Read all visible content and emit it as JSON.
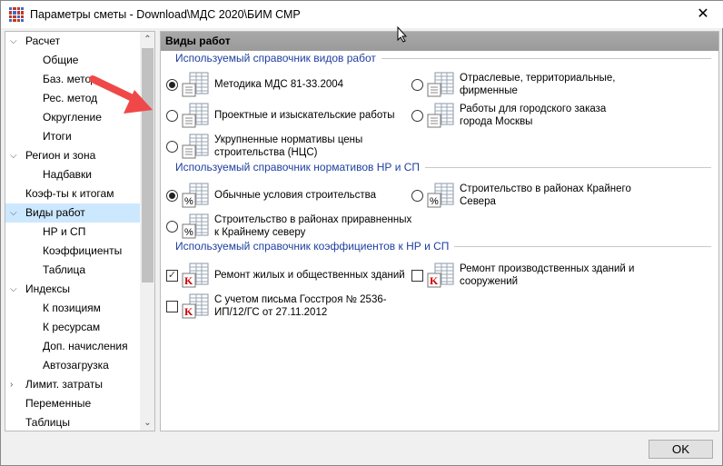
{
  "window": {
    "title": "Параметры сметы - Download\\МДС 2020\\БИМ СМР",
    "close": "✕"
  },
  "sidebar": {
    "items": [
      {
        "label": "Расчет",
        "level": 0,
        "chev": "⌵"
      },
      {
        "label": "Общие",
        "level": 1
      },
      {
        "label": "Баз. метод",
        "level": 1
      },
      {
        "label": "Рес. метод",
        "level": 1
      },
      {
        "label": "Округление",
        "level": 1
      },
      {
        "label": "Итоги",
        "level": 1
      },
      {
        "label": "Регион и зона",
        "level": 0,
        "chev": "⌵"
      },
      {
        "label": "Надбавки",
        "level": 1
      },
      {
        "label": "Коэф-ты к итогам",
        "level": 0
      },
      {
        "label": "Виды работ",
        "level": 0,
        "chev": "⌵",
        "selected": true
      },
      {
        "label": "НР и СП",
        "level": 1
      },
      {
        "label": "Коэффициенты",
        "level": 1
      },
      {
        "label": "Таблица",
        "level": 1
      },
      {
        "label": "Индексы",
        "level": 0,
        "chev": "⌵"
      },
      {
        "label": "К позициям",
        "level": 1
      },
      {
        "label": "К ресурсам",
        "level": 1
      },
      {
        "label": "Доп. начисления",
        "level": 1
      },
      {
        "label": "Автозагрузка",
        "level": 1
      },
      {
        "label": "Лимит. затраты",
        "level": 0,
        "chev": "›"
      },
      {
        "label": "Переменные",
        "level": 0
      },
      {
        "label": "Таблицы",
        "level": 0
      }
    ]
  },
  "main": {
    "header": "Виды работ",
    "groups": [
      {
        "title": "Используемый справочник видов работ"
      },
      {
        "title": "Используемый справочник нормативов НР и СП"
      },
      {
        "title": "Используемый справочник коэффициентов к НР и СП"
      }
    ],
    "options": [
      {
        "label": "Методика МДС 81-33.2004",
        "type": "radio",
        "checked": true
      },
      {
        "label": "Отраслевые, территориальные, фирменные",
        "type": "radio",
        "checked": false
      },
      {
        "label": "Проектные и изыскательские работы",
        "type": "radio",
        "checked": false
      },
      {
        "label": "Работы для городского заказа города Москвы",
        "type": "radio",
        "checked": false
      },
      {
        "label": "Укрупненные нормативы цены строительства (НЦС)",
        "type": "radio",
        "checked": false
      },
      {
        "label": "Обычные условия строительства",
        "type": "radio",
        "checked": true
      },
      {
        "label": "Строительство в районах Крайнего Севера",
        "type": "radio",
        "checked": false
      },
      {
        "label": "Строительство в районах приравненных к Крайнему северу",
        "type": "radio",
        "checked": false
      },
      {
        "label": "Ремонт жилых и общественных зданий",
        "type": "check",
        "checked": true
      },
      {
        "label": "Ремонт производственных зданий и сооружений",
        "type": "check",
        "checked": false
      },
      {
        "label": "С учетом письма Госстроя № 2536-ИП/12/ГС от 27.11.2012",
        "type": "check",
        "checked": false
      }
    ]
  },
  "footer": {
    "ok": "OK"
  }
}
